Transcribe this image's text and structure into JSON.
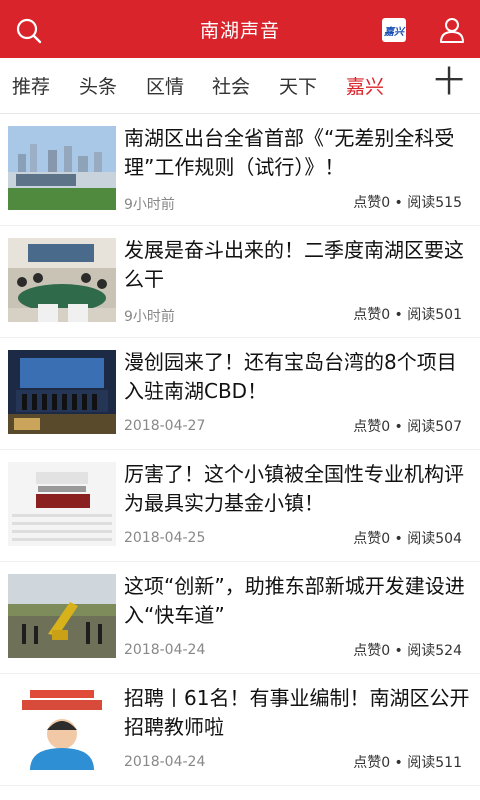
{
  "header": {
    "title": "南湖声音",
    "badge_text": "嘉兴"
  },
  "tabs": [
    "推荐",
    "头条",
    "区情",
    "社会",
    "天下",
    "嘉兴"
  ],
  "active_tab": 5,
  "add_tab_label": "十",
  "articles": [
    {
      "title": "南湖区出台全省首部《“无差别全科受理”工作规则（试行）》！",
      "time": "9小时前",
      "stats": "点赞0 • 阅读515",
      "thumb": "city-skyline"
    },
    {
      "title": "发展是奋斗出来的！二季度南湖区要这么干",
      "time": "9小时前",
      "stats": "点赞0 • 阅读501",
      "thumb": "meeting-room"
    },
    {
      "title": "漫创园来了！还有宝岛台湾的8个项目入驻南湖CBD！",
      "time": "2018-04-27",
      "stats": "点赞0 • 阅读507",
      "thumb": "stage-event"
    },
    {
      "title": "厉害了！这个小镇被全国性专业机构评为最具实力基金小镇！",
      "time": "2018-04-25",
      "stats": "点赞0 • 阅读504",
      "thumb": "top5-ranking"
    },
    {
      "title": "这项“创新”，助推东部新城开发建设进入“快车道”",
      "time": "2018-04-24",
      "stats": "点赞0 • 阅读524",
      "thumb": "excavator-site"
    },
    {
      "title": "招聘丨61名！有事业编制！南湖区公开招聘教师啦",
      "time": "2018-04-24",
      "stats": "点赞0 • 阅读511",
      "thumb": "we-want-you"
    }
  ],
  "colors": {
    "brand_red": "#d8242a",
    "text_dark": "#111111",
    "text_meta": "#888888"
  }
}
